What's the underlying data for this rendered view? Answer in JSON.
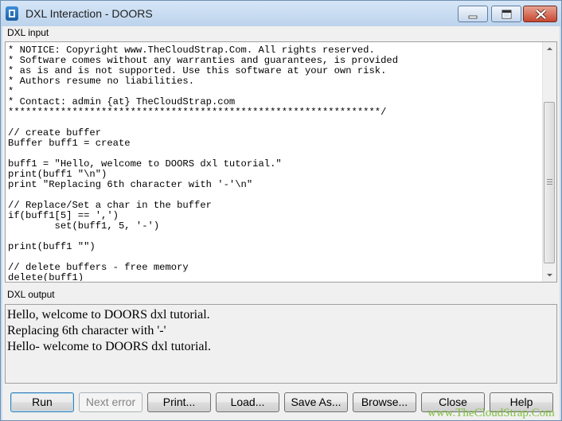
{
  "window": {
    "title": "DXL Interaction - DOORS",
    "controls": {
      "minimize": "minimize",
      "maximize": "maximize",
      "close": "close"
    }
  },
  "input_section": {
    "label": "DXL input",
    "code_lines": [
      "* NOTICE: Copyright www.TheCloudStrap.Com. All rights reserved.",
      "* Software comes without any warranties and guarantees, is provided",
      "* as is and is not supported. Use this software at your own risk.",
      "* Authors resume no liabilities.",
      "*",
      "* Contact: admin {at} TheCloudStrap.com",
      "****************************************************************/",
      "",
      "// create buffer",
      "Buffer buff1 = create",
      "",
      "buff1 = \"Hello, welcome to DOORS dxl tutorial.\"",
      "print(buff1 \"\\n\")",
      "print \"Replacing 6th character with '-'\\n\"",
      "",
      "// Replace/Set a char in the buffer",
      "if(buff1[5] == ',')",
      "        set(buff1, 5, '-')",
      "",
      "print(buff1 \"\")",
      "",
      "// delete buffers - free memory",
      "delete(buff1)"
    ]
  },
  "output_section": {
    "label": "DXL output",
    "lines": [
      "Hello, welcome to DOORS dxl tutorial.",
      "Replacing 6th character with '-'",
      "Hello- welcome to DOORS dxl tutorial."
    ]
  },
  "buttons": {
    "run": "Run",
    "next_error": "Next error",
    "print": "Print...",
    "load": "Load...",
    "save_as": "Save As...",
    "browse": "Browse...",
    "close": "Close",
    "help": "Help"
  },
  "watermark": "www.TheCloudStrap.Com",
  "colors": {
    "watermark": "#7fbf3f",
    "titlebar": "#c9dcf0",
    "close_button": "#c7472e"
  }
}
